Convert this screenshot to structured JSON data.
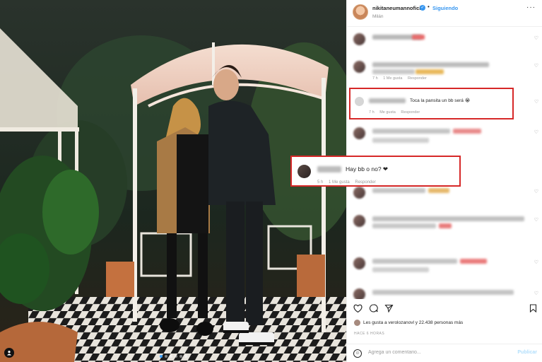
{
  "post": {
    "username": "nikitaneumannoficial",
    "follow_label": "Siguiendo",
    "location": "Milán",
    "verified_icon": "verified-badge-icon",
    "more_icon": "more-options-icon"
  },
  "comments": {
    "highlighted_1": {
      "text": "Toca la pansita un bb será 😭",
      "time": "7 h",
      "likes": "Me gusta",
      "reply": "Responder"
    },
    "highlighted_2": {
      "text": "Hay bb o no? ❤",
      "time": "5 h",
      "likes": "1 Me gusta",
      "reply": "Responder"
    },
    "row_meta": [
      {
        "time": "7 h",
        "likes": "1 Me gusta",
        "reply": "Responder"
      },
      {
        "time": "7 h",
        "likes": "Me gusta",
        "reply": "Responder"
      }
    ]
  },
  "actions": {
    "like_icon": "heart-icon",
    "comment_icon": "comment-icon",
    "share_icon": "share-icon",
    "save_icon": "bookmark-icon"
  },
  "likes": {
    "text": "Les gusta a verolozanovl y 22.438 personas más"
  },
  "timestamp": "HACE 6 HORAS",
  "add_comment": {
    "placeholder": "Agrega un comentario...",
    "publish_label": "Publicar"
  },
  "colors": {
    "accent": "#3897f0",
    "highlight_box": "#d62828"
  }
}
